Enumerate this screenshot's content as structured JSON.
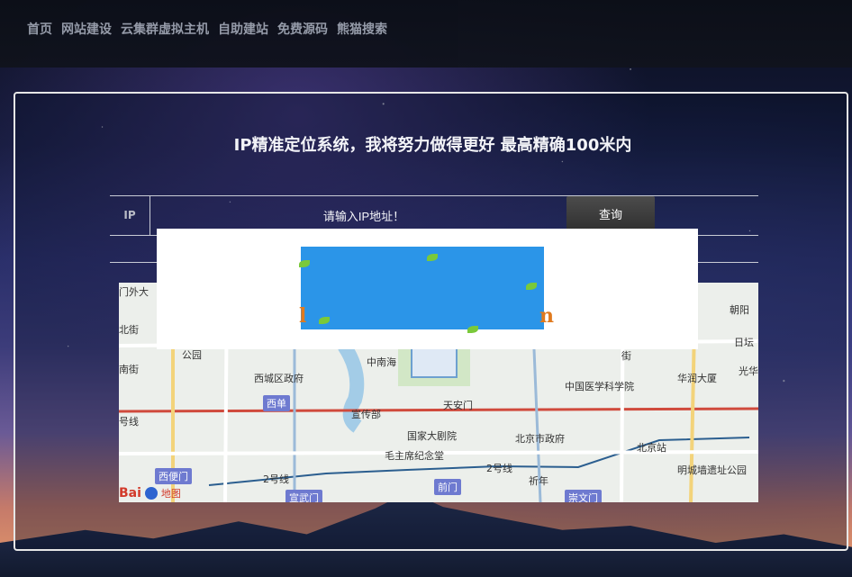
{
  "nav": {
    "items": [
      "首页",
      "网站建设",
      "云集群虚拟主机",
      "自助建站",
      "免费源码",
      "熊猫搜索"
    ]
  },
  "page": {
    "title": "IP精准定位系统，我将努力做得更好 最高精确100米内"
  },
  "form": {
    "ip_label": "IP",
    "ip_placeholder": "请输入IP地址！",
    "submit_label": "查询"
  },
  "overlay": {
    "letter_left": "l",
    "letter_right": "n"
  },
  "map": {
    "labels": [
      "西城区政府",
      "中南海",
      "西单",
      "宣传部",
      "天安门",
      "国家大剧院",
      "毛主席纪念堂",
      "北京市政府",
      "中国医学科学院",
      "北京站",
      "明城墙遗址公园",
      "华润大厦",
      "前门",
      "崇文门",
      "2号线",
      "2号线",
      "号线",
      "地图",
      "西便门",
      "宣武门",
      "门外大",
      "北街",
      "南街",
      "公园",
      "朝阳",
      "日坛",
      "光华",
      "街",
      "祈年"
    ],
    "logo_text": "Bai"
  },
  "colors": {
    "accent_button": "#3a3a3a",
    "banner_blue": "#2b95e8",
    "text_light": "#f3f4f8"
  }
}
